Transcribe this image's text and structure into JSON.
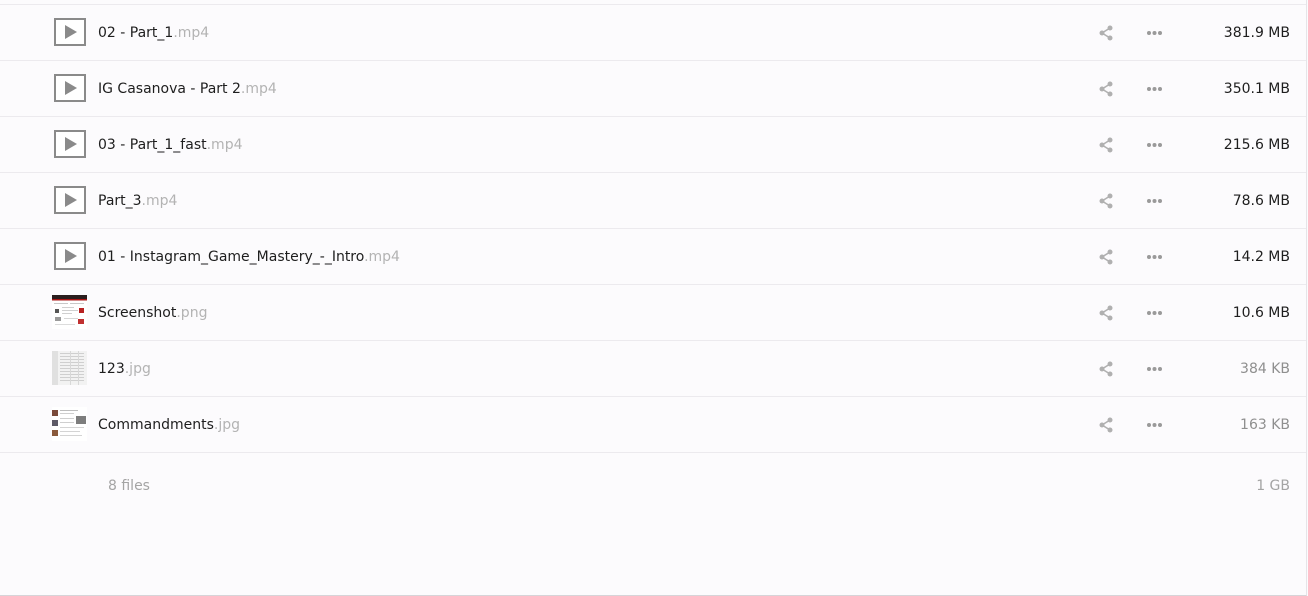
{
  "files": [
    {
      "base": "02 - Part_1",
      "ext": ".mp4",
      "size": "381.9 MB",
      "type": "video"
    },
    {
      "base": "IG Casanova - Part 2",
      "ext": ".mp4",
      "size": "350.1 MB",
      "type": "video"
    },
    {
      "base": "03 - Part_1_fast",
      "ext": ".mp4",
      "size": "215.6 MB",
      "type": "video"
    },
    {
      "base": "Part_3",
      "ext": ".mp4",
      "size": "78.6 MB",
      "type": "video"
    },
    {
      "base": "01 - Instagram_Game_Mastery_-_Intro",
      "ext": ".mp4",
      "size": "14.2 MB",
      "type": "video"
    },
    {
      "base": "Screenshot",
      "ext": ".png",
      "size": "10.6 MB",
      "type": "image"
    },
    {
      "base": "123",
      "ext": ".jpg",
      "size": "384 KB",
      "type": "image"
    },
    {
      "base": "Commandments",
      "ext": ".jpg",
      "size": "163 KB",
      "type": "image"
    }
  ],
  "summary": {
    "count": "8 files",
    "total": "1 GB"
  },
  "icons": {
    "share": "share-icon",
    "more": "more-icon",
    "video": "play-icon"
  },
  "colors": {
    "background": "#fcfbfd",
    "icon": "#a6a6a6",
    "extension": "#b3b3b3",
    "muted_size": "#8f8f8f"
  }
}
